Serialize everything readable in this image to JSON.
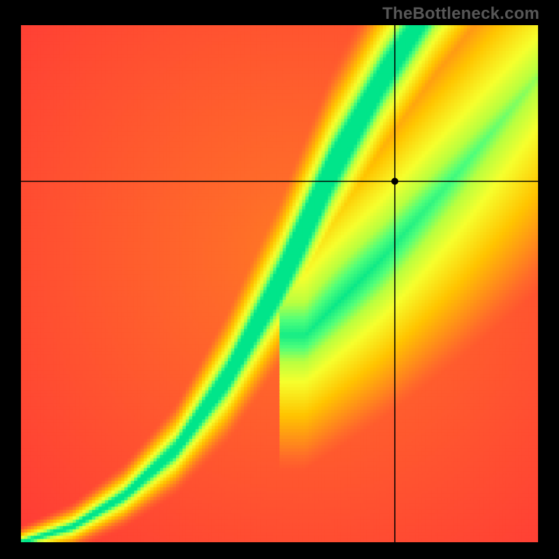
{
  "watermark": "TheBottleneck.com",
  "chart_data": {
    "type": "heatmap",
    "title": "",
    "xlabel": "",
    "ylabel": "",
    "xlim": [
      0,
      1
    ],
    "ylim": [
      0,
      1
    ],
    "legend": false,
    "grid": false,
    "crosshair": {
      "x": 0.723,
      "y": 0.698
    },
    "colormap": [
      {
        "t": 0.0,
        "hex": "#ff2a3a"
      },
      {
        "t": 0.25,
        "hex": "#ff6a2a"
      },
      {
        "t": 0.5,
        "hex": "#ffc400"
      },
      {
        "t": 0.7,
        "hex": "#f6ff2d"
      },
      {
        "t": 0.82,
        "hex": "#b8ff40"
      },
      {
        "t": 0.9,
        "hex": "#50ff7a"
      },
      {
        "t": 1.0,
        "hex": "#00e58a"
      }
    ],
    "ridge": {
      "description": "Green optimal band along a curve y = f(x); heat value = 1 - clamp(|y - f(x)| / width(x))",
      "control_points": [
        {
          "x": 0.0,
          "y": 0.0,
          "w": 0.01
        },
        {
          "x": 0.1,
          "y": 0.03,
          "w": 0.015
        },
        {
          "x": 0.2,
          "y": 0.09,
          "w": 0.02
        },
        {
          "x": 0.3,
          "y": 0.18,
          "w": 0.028
        },
        {
          "x": 0.4,
          "y": 0.32,
          "w": 0.04
        },
        {
          "x": 0.5,
          "y": 0.5,
          "w": 0.05
        },
        {
          "x": 0.6,
          "y": 0.72,
          "w": 0.06
        },
        {
          "x": 0.7,
          "y": 0.9,
          "w": 0.065
        },
        {
          "x": 0.8,
          "y": 1.05,
          "w": 0.07
        },
        {
          "x": 0.9,
          "y": 1.18,
          "w": 0.075
        },
        {
          "x": 1.0,
          "y": 1.3,
          "w": 0.08
        }
      ]
    },
    "secondary_ridge": {
      "description": "Fainter yellow diagonal band toward top-right",
      "control_points": [
        {
          "x": 0.55,
          "y": 0.4,
          "w": 0.1
        },
        {
          "x": 0.7,
          "y": 0.55,
          "w": 0.12
        },
        {
          "x": 0.85,
          "y": 0.72,
          "w": 0.14
        },
        {
          "x": 1.0,
          "y": 0.9,
          "w": 0.16
        }
      ],
      "peak": 0.72
    },
    "grid_resolution": 160
  }
}
